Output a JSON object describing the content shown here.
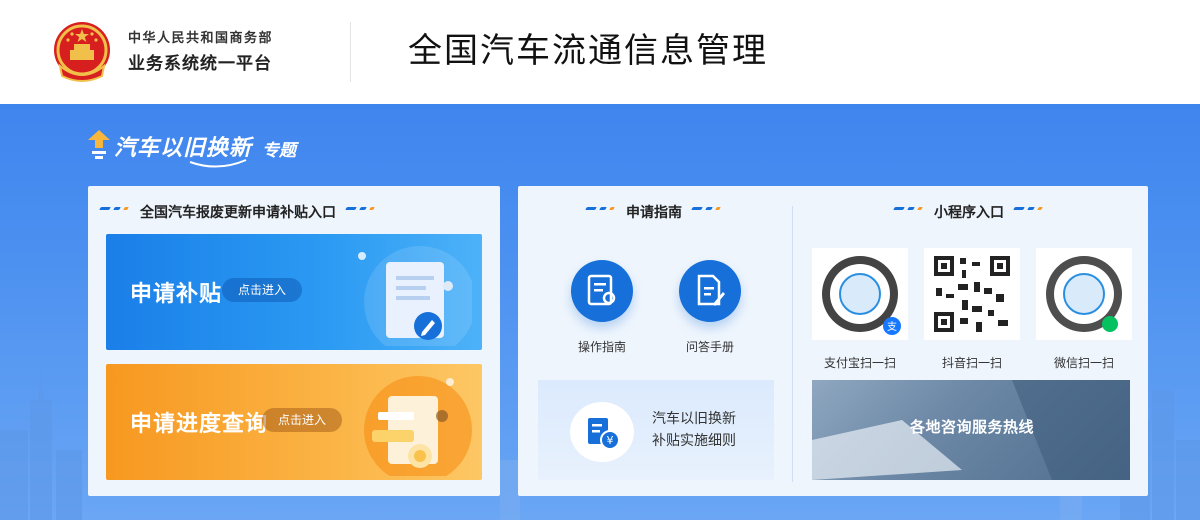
{
  "header": {
    "org_line1": "中华人民共和国商务部",
    "org_line2": "业务系统统一平台",
    "site_title": "全国汽车流通信息管理"
  },
  "topic": {
    "main": "汽车以旧换新",
    "sub": "专题"
  },
  "left_panel": {
    "title": "全国汽车报废更新申请补贴入口",
    "cards": [
      {
        "title": "申请补贴",
        "button": "点击进入"
      },
      {
        "title": "申请进度查询",
        "button": "点击进入"
      }
    ]
  },
  "guide_panel": {
    "title": "申请指南",
    "items": [
      {
        "label": "操作指南",
        "icon": "operation-guide-icon"
      },
      {
        "label": "问答手册",
        "icon": "qa-manual-icon"
      }
    ],
    "detail_line1": "汽车以旧换新",
    "detail_line2": "补贴实施细则"
  },
  "mini_panel": {
    "title": "小程序入口",
    "qrs": [
      {
        "label": "支付宝扫一扫",
        "badge": "支",
        "badge_color": "#1677ff"
      },
      {
        "label": "抖音扫一扫",
        "badge": "",
        "badge_color": ""
      },
      {
        "label": "微信扫一扫",
        "badge": "",
        "badge_color": "#07c160"
      }
    ],
    "hotline": "各地咨询服务热线"
  },
  "colors": {
    "primary_blue": "#1770d9",
    "hero_blue": "#3f85ee",
    "accent_orange": "#f79820",
    "panel_bg": "#eef5fd"
  }
}
